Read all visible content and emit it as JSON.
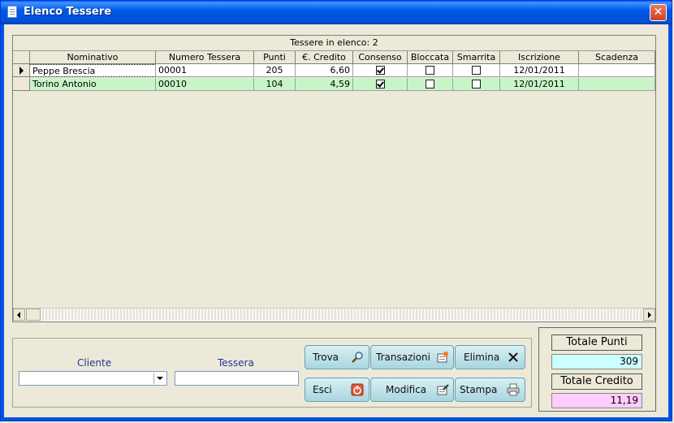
{
  "window": {
    "title": "Elenco Tessere",
    "close_label": "✕"
  },
  "grid": {
    "caption": "Tessere in elenco: 2",
    "columns": [
      "Nominativo",
      "Numero Tessera",
      "Punti",
      "€. Credito",
      "Consenso",
      "Bloccata",
      "Smarrita",
      "Iscrizione",
      "Scadenza"
    ],
    "rows": [
      {
        "nominativo": "Peppe Brescia",
        "numero": "00001",
        "punti": "205",
        "credito": "6,60",
        "consenso": true,
        "bloccata": false,
        "smarrita": false,
        "iscrizione": "12/01/2011",
        "scadenza": ""
      },
      {
        "nominativo": "Torino Antonio",
        "numero": "00010",
        "punti": "104",
        "credito": "4,59",
        "consenso": true,
        "bloccata": false,
        "smarrita": false,
        "iscrizione": "12/01/2011",
        "scadenza": ""
      }
    ]
  },
  "filters": {
    "cliente_label": "Cliente",
    "cliente_value": "",
    "tessera_label": "Tessera",
    "tessera_value": ""
  },
  "buttons": {
    "trova": "Trova",
    "transazioni": "Transazioni",
    "elimina": "Elimina",
    "esci": "Esci",
    "modifica": "Modifica",
    "stampa": "Stampa"
  },
  "totals": {
    "punti_label": "Totale Punti",
    "punti_value": "309",
    "credito_label": "Totale Credito",
    "credito_value": "11,19",
    "punti_color": "#ccffff",
    "credito_color": "#ffccff"
  },
  "colors": {
    "row_alt": "#c8f5c8",
    "title_bar": "#0054e3"
  }
}
